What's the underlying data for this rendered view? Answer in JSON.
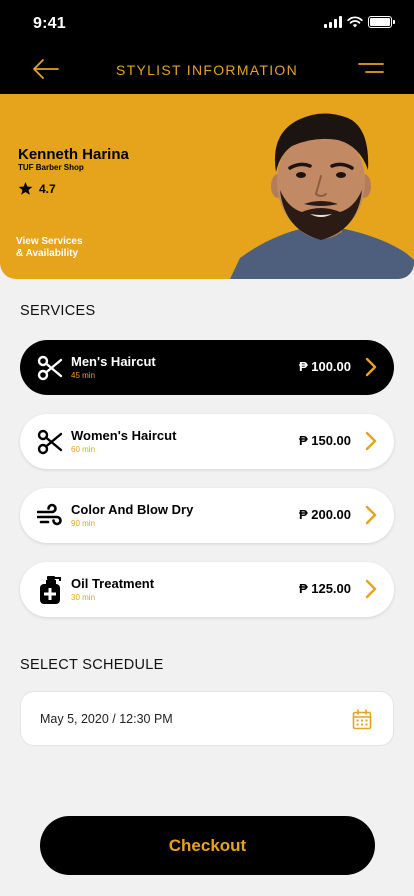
{
  "status_bar": {
    "time": "9:41"
  },
  "header": {
    "title": "STYLIST INFORMATION"
  },
  "stylist": {
    "name": "Kenneth Harina",
    "shop": "TUF Barber Shop",
    "rating": "4.7",
    "view_link_line1": "View Services",
    "view_link_line2": "& Availability"
  },
  "services_section": {
    "label": "SERVICES"
  },
  "services": [
    {
      "name": "Men's Haircut",
      "duration": "45 min",
      "price": "₱ 100.00",
      "icon": "scissors-icon",
      "selected": true
    },
    {
      "name": "Women's Haircut",
      "duration": "60 min",
      "price": "₱ 150.00",
      "icon": "scissors-icon",
      "selected": false
    },
    {
      "name": "Color And Blow Dry",
      "duration": "90 min",
      "price": "₱ 200.00",
      "icon": "wind-icon",
      "selected": false
    },
    {
      "name": "Oil Treatment",
      "duration": "30 min",
      "price": "₱ 125.00",
      "icon": "oil-bottle-icon",
      "selected": false
    }
  ],
  "schedule_section": {
    "label": "SELECT SCHEDULE",
    "value": "May 5, 2020 / 12:30 PM"
  },
  "checkout": {
    "label": "Checkout"
  },
  "colors": {
    "accent": "#e6a31c",
    "dark": "#000000",
    "background": "#f1f1f1"
  }
}
